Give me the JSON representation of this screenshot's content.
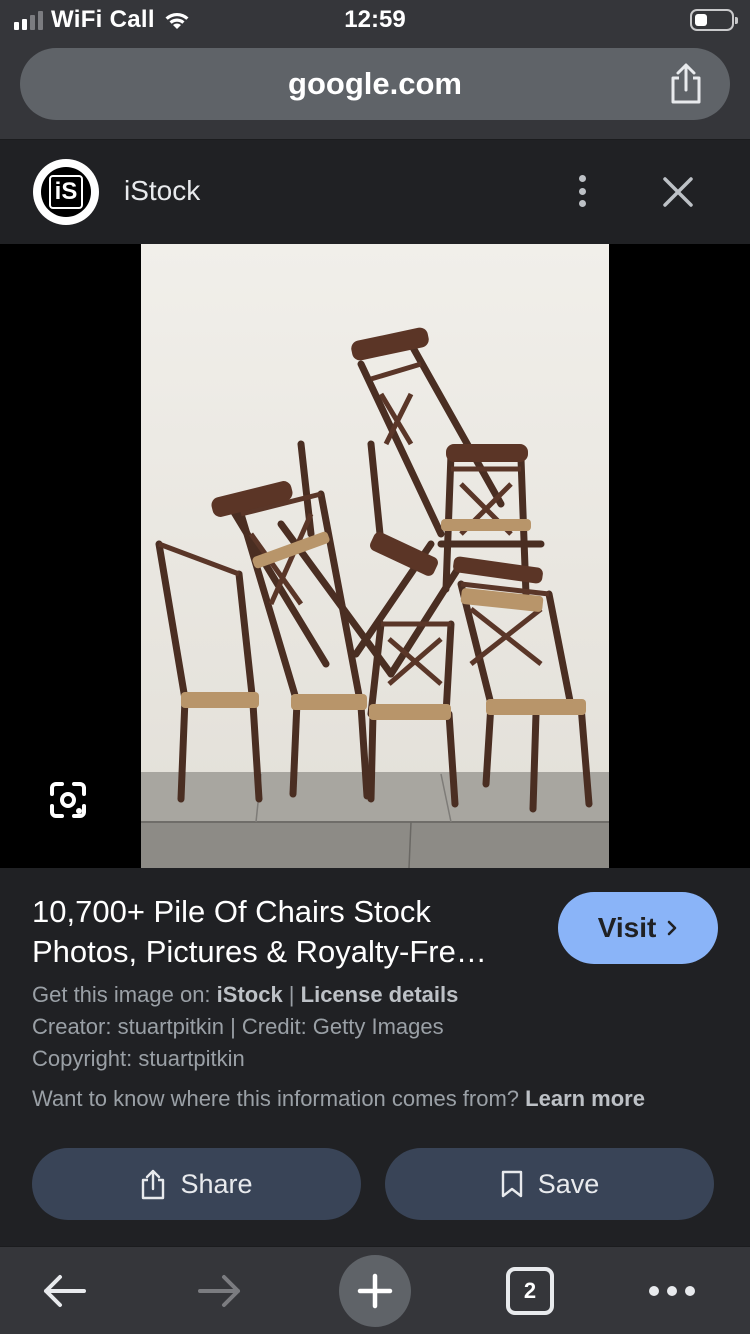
{
  "status_bar": {
    "carrier": "WiFi Call",
    "time": "12:59",
    "icons": [
      "signal-icon",
      "wifi-icon",
      "battery-icon"
    ]
  },
  "browser": {
    "url": "google.com",
    "tab_count": "2"
  },
  "source": {
    "logo_text": "iS",
    "name": "iStock"
  },
  "result": {
    "title_line1": "10,700+ Pile Of Chairs Stock",
    "title_line2": "Photos, Pictures & Royalty-Fre…",
    "visit_label": "Visit",
    "get_image_prefix": "Get this image on: ",
    "get_image_source": "iStock",
    "separator": " | ",
    "license_label": "License details",
    "creator_line": "Creator: stuartpitkin | Credit: Getty Images",
    "copyright_line": "Copyright: stuartpitkin",
    "info_question": "Want to know where this information comes from? ",
    "learn_more": "Learn more",
    "share_label": "Share",
    "save_label": "Save"
  },
  "colors": {
    "visit_button": "#8ab4f8",
    "action_button": "#394457",
    "background": "#202124",
    "chrome": "#35363a"
  }
}
